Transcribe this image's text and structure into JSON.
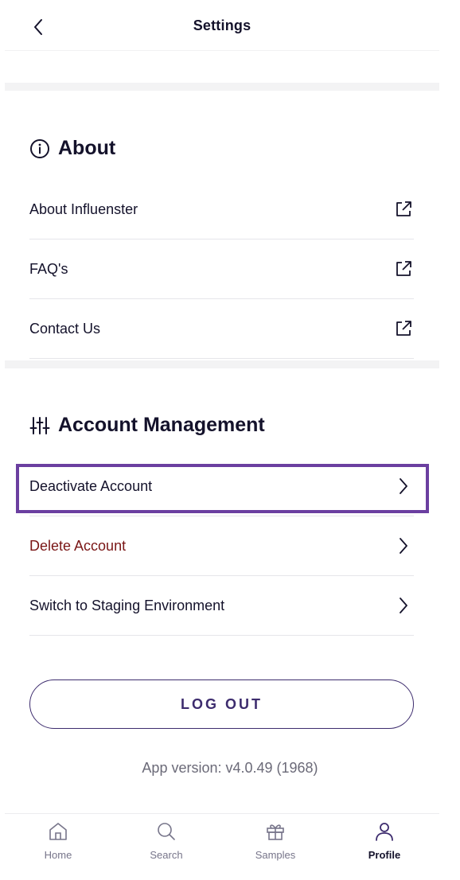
{
  "header": {
    "title": "Settings"
  },
  "about": {
    "title": "About",
    "items": [
      {
        "label": "About Influenster",
        "icon": "external-link-icon"
      },
      {
        "label": "FAQ's",
        "icon": "external-link-icon"
      },
      {
        "label": "Contact Us",
        "icon": "external-link-icon"
      }
    ]
  },
  "account": {
    "title": "Account Management",
    "items": [
      {
        "label": "Deactivate Account",
        "icon": "chevron-right-icon"
      },
      {
        "label": "Delete Account",
        "icon": "chevron-right-icon"
      },
      {
        "label": "Switch to Staging Environment",
        "icon": "chevron-right-icon"
      }
    ]
  },
  "logout_label": "LOG OUT",
  "version": "App version: v4.0.49 (1968)",
  "tabs": [
    {
      "label": "Home",
      "icon": "home-icon"
    },
    {
      "label": "Search",
      "icon": "search-icon"
    },
    {
      "label": "Samples",
      "icon": "gift-icon"
    },
    {
      "label": "Profile",
      "icon": "user-icon",
      "active": true
    }
  ],
  "colors": {
    "text": "#14122b",
    "danger": "#7a1616",
    "accent": "#3d2c6e",
    "highlight": "#6b3fa0"
  }
}
